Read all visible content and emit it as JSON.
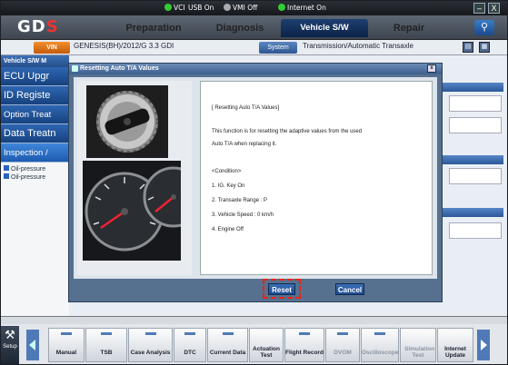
{
  "status": {
    "vci": "VCI",
    "usb": "USB On",
    "vmi": "VMI",
    "vmi_state": "Off",
    "internet": "Internet",
    "internet_state": "On",
    "minimize": "–",
    "close": "X"
  },
  "nav": {
    "logo_main": "GD",
    "logo_accent": "S",
    "tabs": [
      "Preparation",
      "Diagnosis",
      "Vehicle S/W Management",
      "Repair"
    ],
    "active_tab": "Vehicle S/W Management"
  },
  "vehicle": {
    "vin_label": "VIN",
    "model": "GENESIS(BH)/2012/G 3.3 GDI",
    "system_label": "System",
    "system_value": "Transmission/Automatic Transaxle"
  },
  "sidebar": {
    "header": "Vehicle S/W M",
    "items": [
      "ECU Upgr",
      "ID Registe",
      "Option Treat",
      "Data Treatn",
      "Inspection /"
    ],
    "sub_items": [
      "Oil-pressure",
      "Oil-pressure"
    ]
  },
  "dialog": {
    "title": "Resetting Auto T/A Values",
    "close": "x",
    "lines": [
      "[ Resetting Auto T/A Values]",
      "This function is for resetting the adaptive values from the used",
      "Auto T/A when replacing it.",
      "<Condition>",
      "1. IG. Key On",
      "2. Transaxle Range : P",
      "3. Vehicle Speed : 0 km/h",
      "4. Engine Off"
    ],
    "reset_label": "Reset",
    "cancel_label": "Cancel"
  },
  "toolbar": {
    "setup": "Setup",
    "buttons": [
      "Manual",
      "TSB",
      "Case Analysis",
      "DTC",
      "Current Data",
      "Actuation Test",
      "Flight Record",
      "DVOM",
      "Oscilloscope",
      "Simulation Test",
      "Internet Update"
    ]
  },
  "colors": {
    "accent_blue": "#1d4c90",
    "status_green": "#33cc33",
    "reset_highlight": "#ee2211"
  }
}
